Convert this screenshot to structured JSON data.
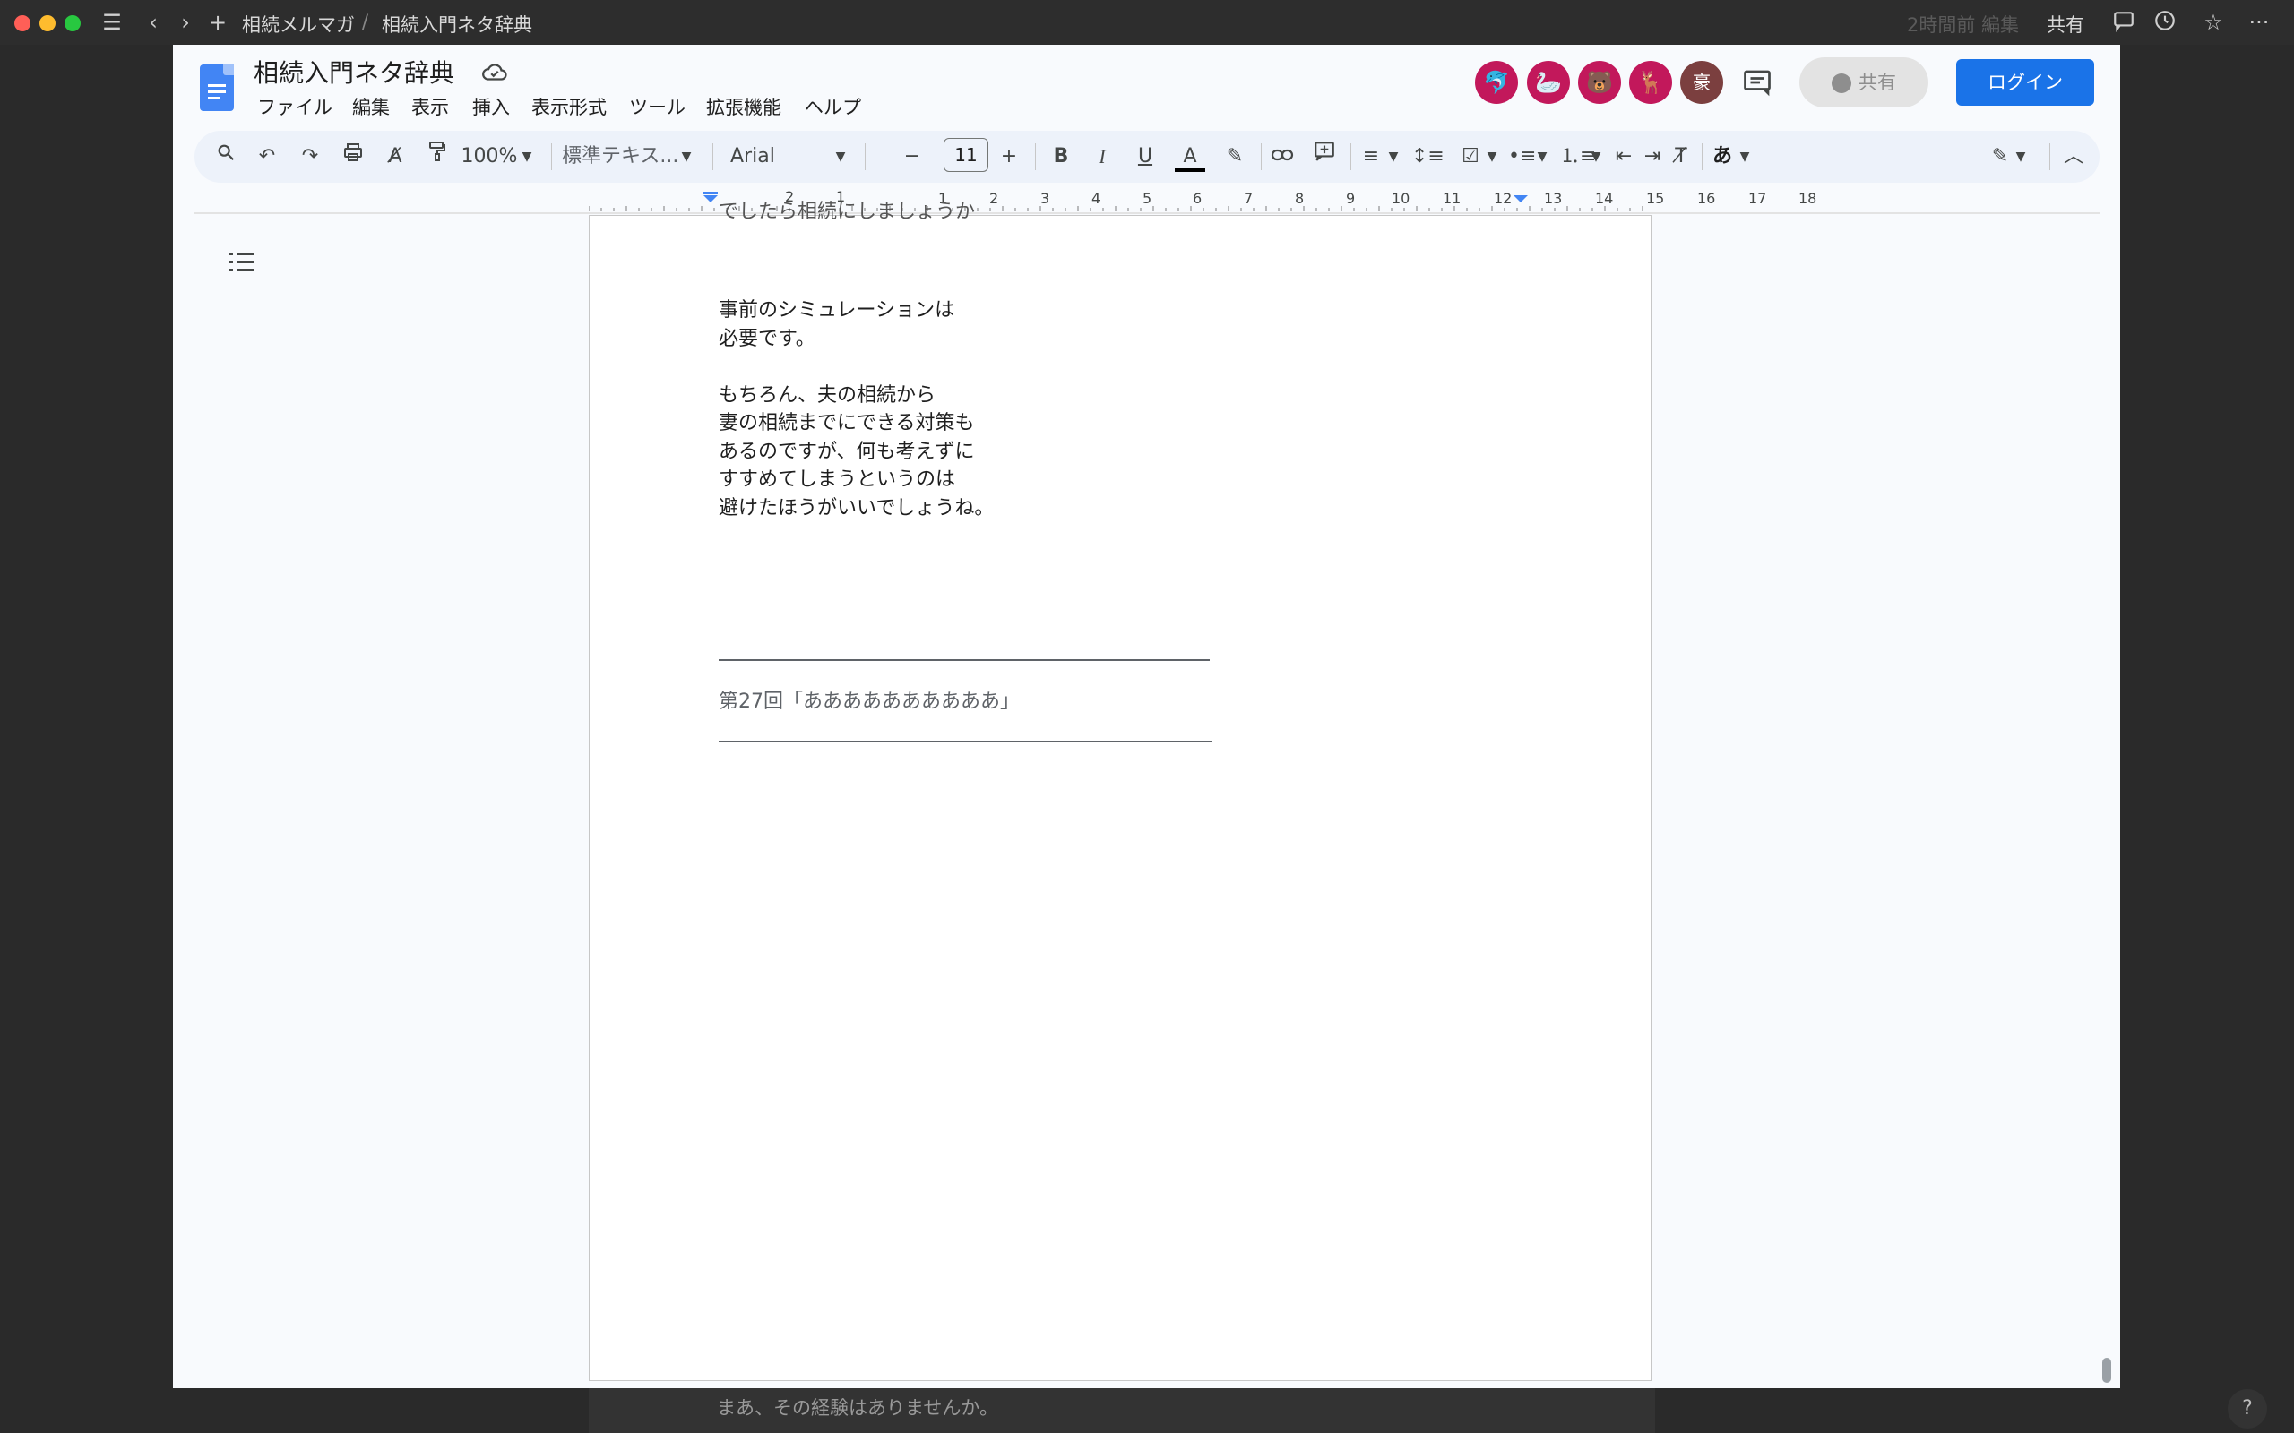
{
  "app": {
    "breadcrumb": [
      "相続メルマガ",
      "/",
      "相続入門ネタ辞典"
    ],
    "top_right": {
      "last_edit": "2時間前 編集",
      "share": "共有"
    }
  },
  "doc": {
    "title": "相続入門ネタ辞典",
    "menus": [
      "ファイル",
      "編集",
      "表示",
      "挿入",
      "表示形式",
      "ツール",
      "拡張機能",
      "ヘルプ"
    ],
    "avatars": [
      {
        "icon": "dolphin-icon",
        "glyph": "🐬"
      },
      {
        "icon": "goose-icon",
        "glyph": "🦢"
      },
      {
        "icon": "bear-icon",
        "glyph": "🐻"
      },
      {
        "icon": "moose-icon",
        "glyph": "🦌"
      },
      {
        "icon": "user-initial",
        "glyph": "豪"
      }
    ],
    "share_label": "共有",
    "login_label": "ログイン"
  },
  "toolbar": {
    "zoom": "100%",
    "style": "標準テキス...",
    "font": "Arial",
    "font_size": "11",
    "input_method": "あ"
  },
  "ruler": {
    "left_numbers": [
      "2",
      "1"
    ],
    "right_numbers": [
      "1",
      "2",
      "3",
      "4",
      "5",
      "6",
      "7",
      "8",
      "9",
      "10",
      "11",
      "12",
      "13",
      "14",
      "15",
      "16",
      "17",
      "18"
    ]
  },
  "content": {
    "partial_line": "でしたら相続にしましょうか",
    "para1": [
      "事前のシミュレーションは",
      "必要です。"
    ],
    "para2": [
      "もちろん、夫の相続から",
      "妻の相続までにできる対策も",
      "あるのですが、何も考えずに",
      "すすめてしまうというのは",
      "避けたほうがいいでしょうね。"
    ],
    "section_heading": "第27回「ああああああああああ」",
    "next_page_text": "まあ、その経験はありませんか。"
  },
  "colors": {
    "accent": "#1a73e8",
    "avatar": "#c2185b",
    "toolbar_bg": "#edf2fa",
    "window_bg": "#f8fafd"
  }
}
